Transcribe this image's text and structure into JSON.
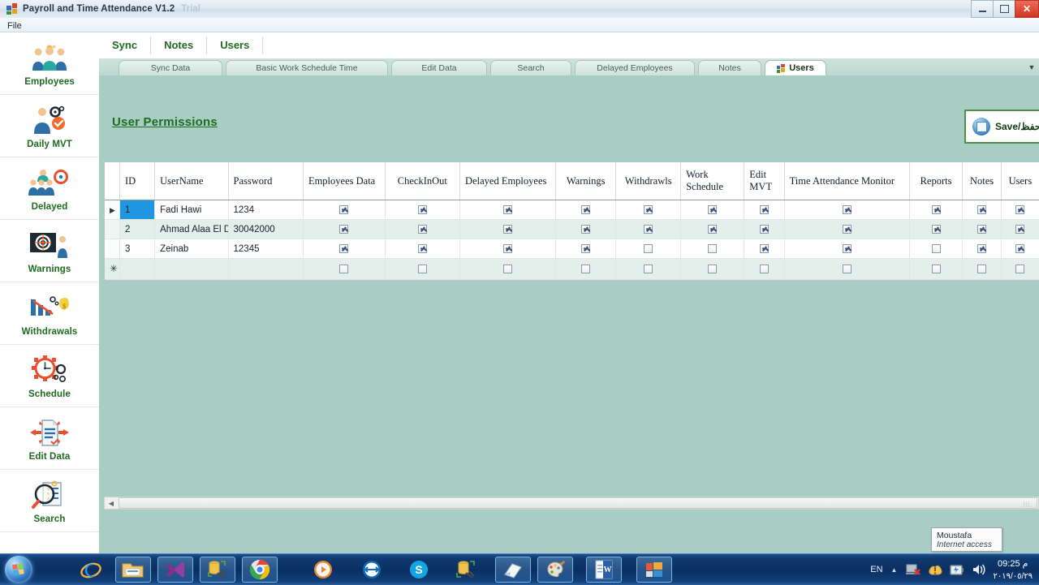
{
  "window": {
    "title": "Payroll and Time Attendance V1.2",
    "title_ghost": "Trial",
    "icon": "app-icon",
    "minimize": "–",
    "maximize": "❐",
    "close": "✕"
  },
  "menubar": {
    "items": [
      {
        "label": "File"
      }
    ]
  },
  "sidebar": {
    "items": [
      {
        "label": "Employees",
        "icon": "employees-group-icon"
      },
      {
        "label": "Daily MVT",
        "icon": "person-gear-check-icon"
      },
      {
        "label": "Delayed",
        "icon": "delayed-people-icon"
      },
      {
        "label": "Warnings",
        "icon": "target-board-icon"
      },
      {
        "label": "Withdrawals",
        "icon": "bar-chart-money-icon"
      },
      {
        "label": "Schedule",
        "icon": "clock-gear-icon"
      },
      {
        "label": "Edit Data",
        "icon": "document-arrows-icon"
      },
      {
        "label": "Search",
        "icon": "magnifier-list-icon"
      }
    ]
  },
  "topnav": {
    "items": [
      {
        "label": "Sync"
      },
      {
        "label": "Notes"
      },
      {
        "label": "Users"
      }
    ]
  },
  "tabstrip": {
    "dropdown": "▼",
    "tabs": [
      {
        "label": "Sync Data",
        "active": false
      },
      {
        "label": "Basic Work Schedule Time",
        "active": false
      },
      {
        "label": "Edit Data",
        "active": false
      },
      {
        "label": "Search",
        "active": false
      },
      {
        "label": "Delayed Employees",
        "active": false
      },
      {
        "label": "Notes",
        "active": false
      },
      {
        "label": "Users",
        "active": true,
        "icon": "app-icon"
      }
    ]
  },
  "page": {
    "title": "User Permissions",
    "save_button": "Save/حفظ",
    "save_icon": "save-disk-icon"
  },
  "grid": {
    "row_header_current": "▶",
    "row_header_new": "✳",
    "columns": [
      "ID",
      "UserName",
      "Password",
      "Employees Data",
      "CheckInOut",
      "Delayed Employees",
      "Warnings",
      "Withdrawls",
      "Work Schedule",
      "Edit MVT",
      "Time Attendance Monitor",
      "Reports",
      "Notes",
      "Users"
    ],
    "rows": [
      {
        "selected": true,
        "id": "1",
        "username": "Fadi Hawi",
        "password": "1234",
        "employees_data": true,
        "checkinout": true,
        "delayed_employees": true,
        "warnings": true,
        "withdrawls": true,
        "work_schedule": true,
        "edit_mvt": true,
        "time_attendance_monitor": true,
        "reports": true,
        "notes": true,
        "users": true
      },
      {
        "selected": false,
        "id": "2",
        "username": "Ahmad Alaa El Din",
        "password": "30042000",
        "employees_data": true,
        "checkinout": true,
        "delayed_employees": true,
        "warnings": true,
        "withdrawls": true,
        "work_schedule": true,
        "edit_mvt": true,
        "time_attendance_monitor": true,
        "reports": true,
        "notes": true,
        "users": true
      },
      {
        "selected": false,
        "id": "3",
        "username": "Zeinab",
        "password": "12345",
        "employees_data": true,
        "checkinout": true,
        "delayed_employees": true,
        "warnings": true,
        "withdrawls": false,
        "work_schedule": false,
        "edit_mvt": true,
        "time_attendance_monitor": true,
        "reports": false,
        "notes": true,
        "users": true
      },
      {
        "selected": false,
        "new_row": true,
        "id": "",
        "username": "",
        "password": "",
        "employees_data": false,
        "checkinout": false,
        "delayed_employees": false,
        "warnings": false,
        "withdrawls": false,
        "work_schedule": false,
        "edit_mvt": false,
        "time_attendance_monitor": false,
        "reports": false,
        "notes": false,
        "users": false
      }
    ]
  },
  "scrollbar": {
    "left_arrow": "◀",
    "grip": "⦙⦙⦙"
  },
  "network_tooltip": {
    "name": "Moustafa",
    "status": "Internet access"
  },
  "taskbar": {
    "start": "start-orb",
    "buttons": [
      {
        "icon": "internet-explorer-icon",
        "framed": false
      },
      {
        "icon": "file-explorer-icon",
        "framed": true
      },
      {
        "icon": "visual-studio-icon",
        "framed": true
      },
      {
        "icon": "sql-tools-icon",
        "framed": true
      },
      {
        "icon": "google-chrome-icon",
        "framed": true
      },
      {
        "icon": "media-player-icon",
        "framed": false
      },
      {
        "icon": "teamviewer-icon",
        "framed": false
      },
      {
        "icon": "skype-icon",
        "framed": false
      },
      {
        "icon": "sql-config-icon",
        "framed": false
      },
      {
        "icon": "sticky-notes-icon",
        "framed": true
      },
      {
        "icon": "paint-icon",
        "framed": true
      },
      {
        "icon": "word-icon",
        "framed": true
      },
      {
        "icon": "payroll-app-icon",
        "framed": true
      }
    ],
    "tray": {
      "language": "EN",
      "chevron": "▲",
      "icons": [
        "network-error-icon",
        "action-center-icon",
        "battery-icon",
        "volume-icon"
      ],
      "time": "09:25 م",
      "date": "٢٠١٩/٠٥/٢٩"
    }
  },
  "colors": {
    "accent_green": "#1f6b1f",
    "panel_teal": "#a8cec4",
    "selection_blue": "#2196e0",
    "alt_row": "#e3efeb"
  }
}
